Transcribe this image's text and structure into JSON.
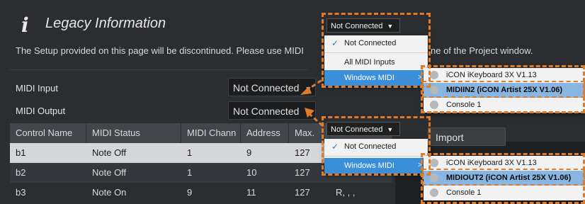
{
  "header": {
    "icon": "i",
    "title": "Legacy Information"
  },
  "notice": {
    "text": "The Setup provided on this page will be discontinued. Please use MIDI",
    "tail": "ne of the Project window."
  },
  "midi_input": {
    "label": "MIDI Input",
    "value": "Not Connected"
  },
  "midi_output": {
    "label": "MIDI Output",
    "value": "Not Connected"
  },
  "table": {
    "columns": [
      "Control Name",
      "MIDI Status",
      "MIDI Chann",
      "Address",
      "Max."
    ],
    "rows": [
      [
        "b1",
        "Note Off",
        "1",
        "9",
        "127",
        ""
      ],
      [
        "b2",
        "Note Off",
        "1",
        "10",
        "127",
        ""
      ],
      [
        "b3",
        "Note On",
        "9",
        "11",
        "127",
        "R, , ,"
      ]
    ]
  },
  "import_button": "Import",
  "popup_input": {
    "select_value": "Not Connected",
    "menu": {
      "checked": "Not Connected",
      "all": "All MIDI Inputs",
      "submenu": "Windows MIDI"
    },
    "devices": [
      "iCON iKeyboard 3X V1.13",
      "MIDIIN2 (iCON Artist 25X V1.06)",
      "Console 1"
    ],
    "highlighted_device": 1
  },
  "popup_output": {
    "select_value": "Not Connected",
    "menu": {
      "checked": "Not Connected",
      "submenu": "Windows MIDI"
    },
    "devices": [
      "iCON iKeyboard 3X V1.13",
      "MIDIOUT2 (iCON Artist 25X V1.06)",
      "Console 1"
    ],
    "highlighted_device": 1
  },
  "colors": {
    "background": "#2b2d30",
    "highlight_blue": "#3b8fd9",
    "callout_orange": "#e07b2a"
  }
}
